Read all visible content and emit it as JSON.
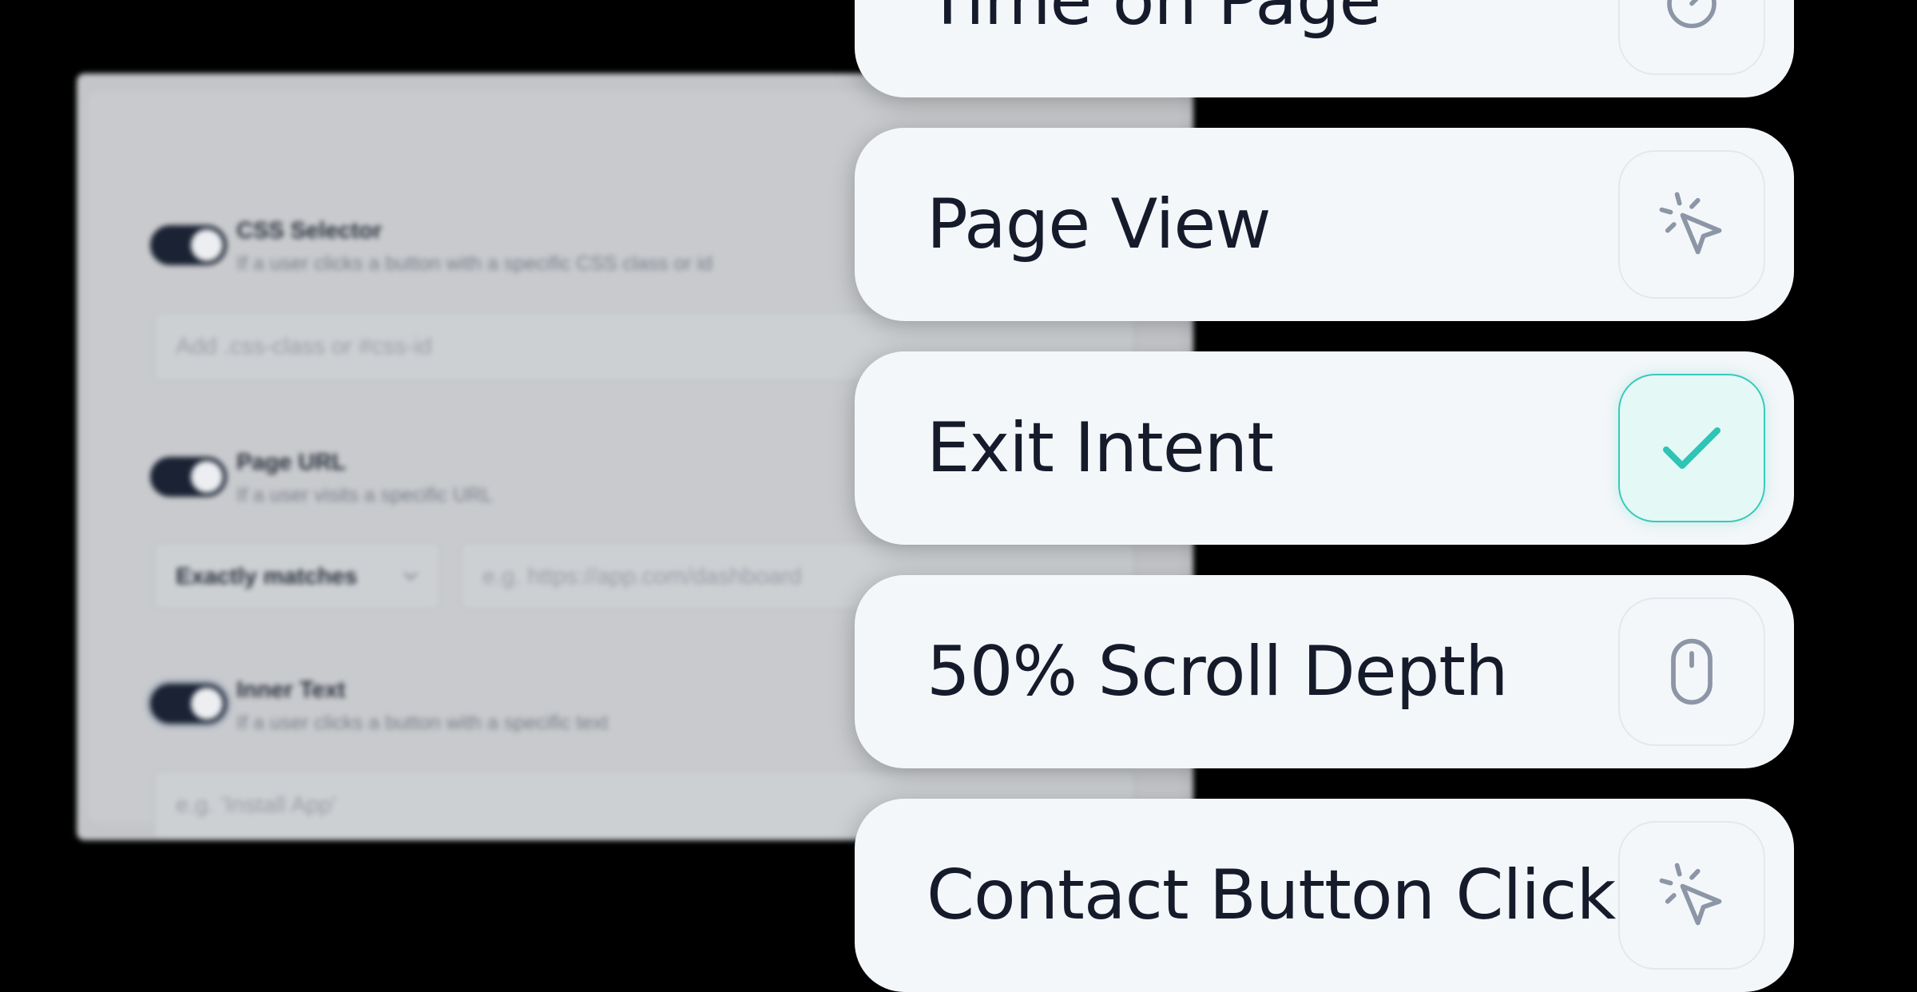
{
  "rules": [
    {
      "title": "CSS Selector",
      "description": "If a user clicks a button with a specific CSS class or id",
      "input_placeholder": "Add .css-class or #css-id",
      "enabled": true
    },
    {
      "title": "Page URL",
      "description": "If a user visits a specific URL",
      "match_select": "Exactly matches",
      "input_placeholder": "e.g. https://app.com/dashboard",
      "enabled": true
    },
    {
      "title": "Inner Text",
      "description": "If a user clicks a button with a specific text",
      "input_placeholder": "e.g. 'Install App'",
      "enabled": true
    }
  ],
  "triggers": [
    {
      "label": "Time on Page",
      "icon": "timer-icon",
      "selected": false
    },
    {
      "label": "Page View",
      "icon": "cursor-click-icon",
      "selected": false
    },
    {
      "label": "Exit Intent",
      "icon": "check-icon",
      "selected": true
    },
    {
      "label": "50% Scroll Depth",
      "icon": "mouse-icon",
      "selected": false
    },
    {
      "label": "Contact Button Click",
      "icon": "cursor-click-icon",
      "selected": false
    }
  ],
  "colors": {
    "background": "#000000",
    "card": "#f4f7f9",
    "text": "#151b2b",
    "accent": "#39c9bb",
    "icon": "#8c96a6"
  }
}
